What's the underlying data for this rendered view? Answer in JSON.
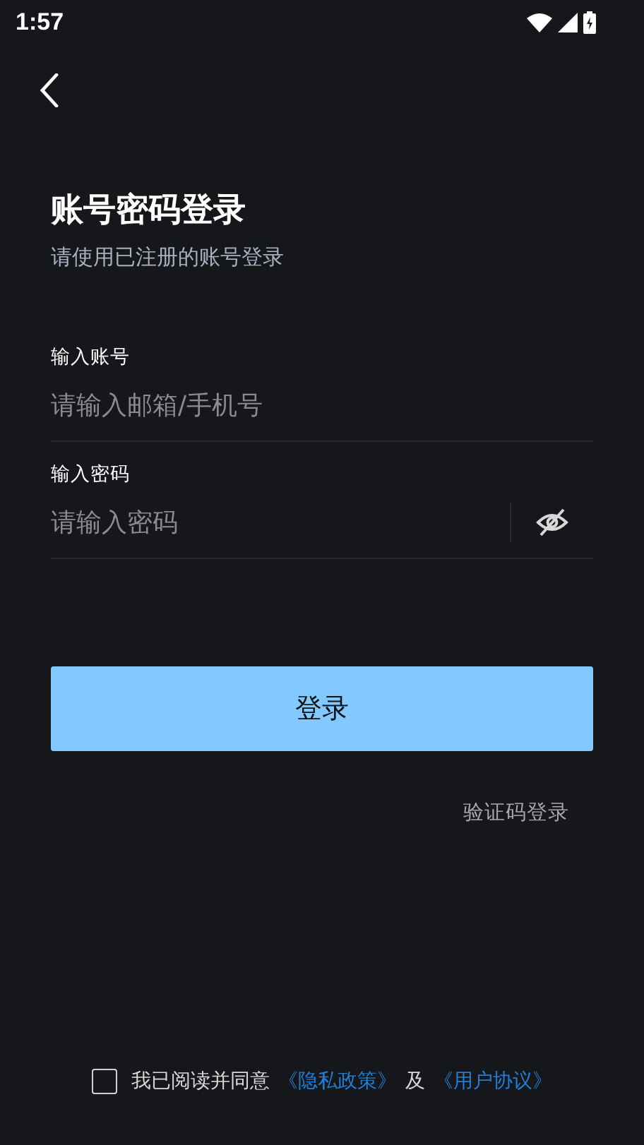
{
  "status_bar": {
    "time": "1:57"
  },
  "title": "账号密码登录",
  "subtitle": "请使用已注册的账号登录",
  "fields": [
    {
      "label": "输入账号",
      "placeholder": "请输入邮箱/手机号",
      "kind": "text"
    },
    {
      "label": "输入密码",
      "placeholder": "请输入密码",
      "kind": "password"
    }
  ],
  "login_button": "登录",
  "alt_login_link": "验证码登录",
  "agreement": {
    "checked": false,
    "text": "我已阅读并同意",
    "privacy_link": "《隐私政策》",
    "joiner": "及",
    "terms_link": "《用户协议》"
  }
}
